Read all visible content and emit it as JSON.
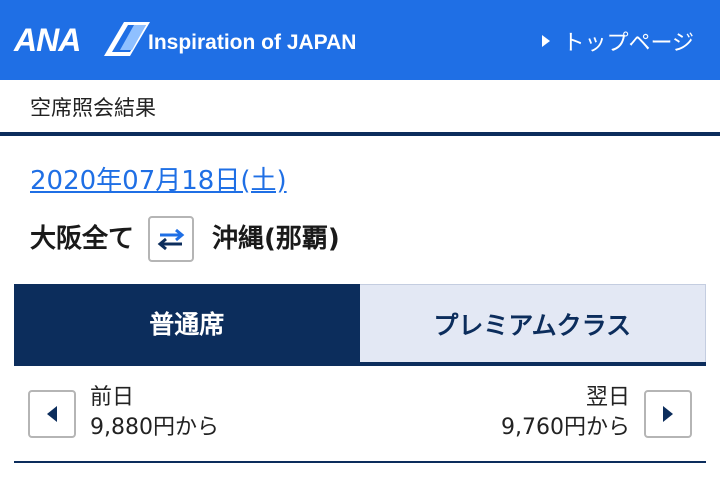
{
  "header": {
    "logo": "ANA",
    "tagline": "Inspiration of JAPAN",
    "top_link": "トップページ"
  },
  "page_title": "空席照会結果",
  "date": "2020年07月18日(土)",
  "route": {
    "origin": "大阪全て",
    "destination": "沖縄(那覇)"
  },
  "tabs": [
    {
      "label": "普通席",
      "active": true
    },
    {
      "label": "プレミアムクラス",
      "active": false
    }
  ],
  "day_nav": {
    "prev_label": "前日",
    "prev_price": "9,880円から",
    "next_label": "翌日",
    "next_price": "9,760円から"
  },
  "colors": {
    "header_blue": "#1f6fe5",
    "navy": "#0c2d5c",
    "link_blue": "#1f6fe5",
    "inactive_tab": "#e3e8f4"
  },
  "icons": [
    "ana-logo-slash-icon",
    "triangle-right-icon",
    "swap-arrows-icon",
    "chevron-left-icon",
    "chevron-right-icon"
  ]
}
